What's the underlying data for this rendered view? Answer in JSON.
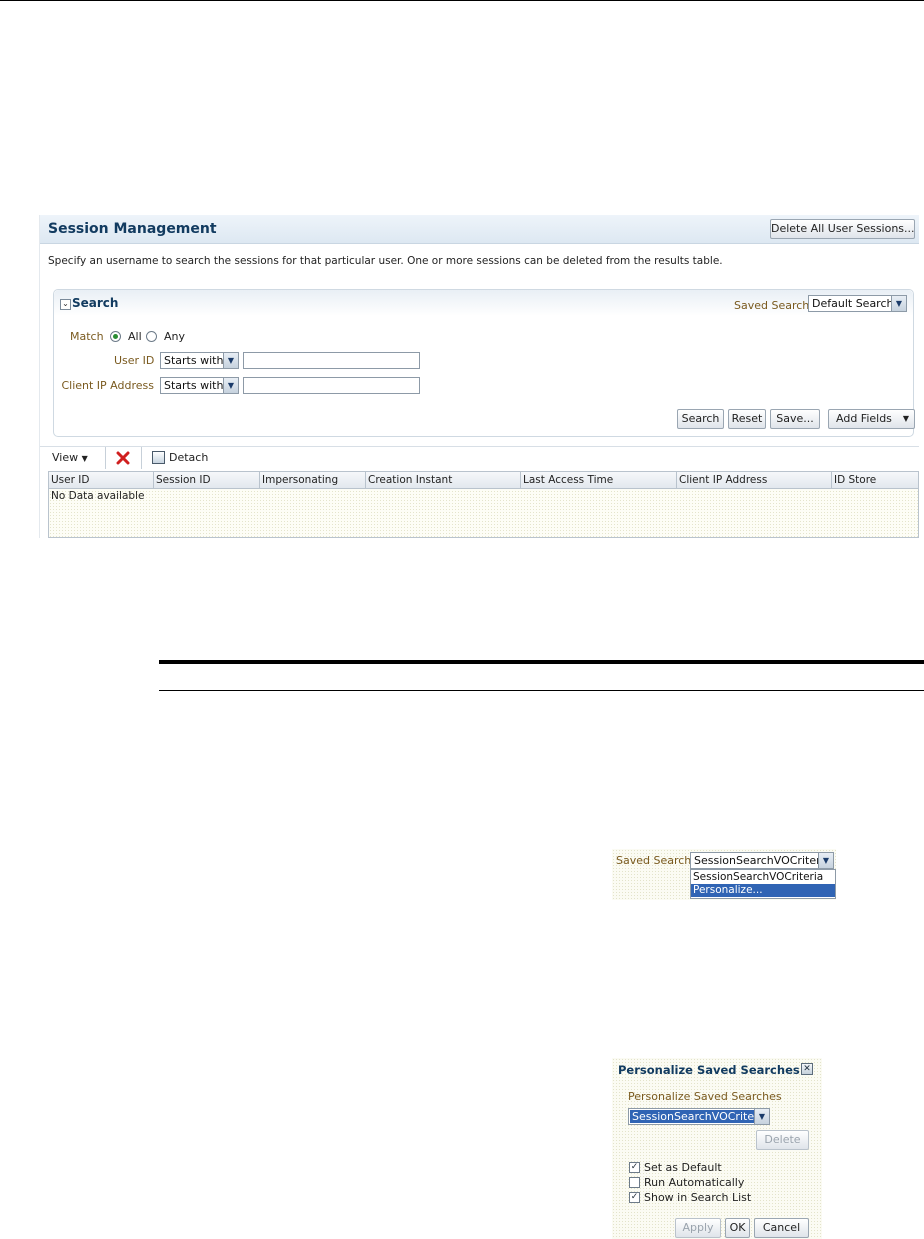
{
  "session_management": {
    "title": "Session Management",
    "delete_all_label": "Delete All User Sessions...",
    "description": "Specify an username to search the sessions for that particular user. One or more sessions can be deleted from the results table."
  },
  "search": {
    "title": "Search",
    "saved_search_label": "Saved Search",
    "saved_search_value": "Default Search",
    "match_label": "Match",
    "match_all": "All",
    "match_any": "Any",
    "match_selected": "All",
    "user_id_label": "User ID",
    "user_id_operator": "Starts with",
    "user_id_value": "",
    "client_ip_label": "Client IP Address",
    "client_ip_operator": "Starts with",
    "client_ip_value": "",
    "buttons": {
      "search": "Search",
      "reset": "Reset",
      "save": "Save...",
      "add_fields": "Add Fields"
    }
  },
  "toolbar": {
    "view": "View",
    "detach": "Detach"
  },
  "table": {
    "columns": [
      "User ID",
      "Session ID",
      "Impersonating",
      "Creation Instant",
      "Last Access Time",
      "Client IP Address",
      "ID Store"
    ],
    "empty_text": "No Data available"
  },
  "saved_search_dropdown": {
    "label": "Saved Search",
    "selected": "SessionSearchVOCriteria",
    "options": [
      "SessionSearchVOCriteria",
      "Personalize..."
    ],
    "highlighted_index": 1
  },
  "personalize_dialog": {
    "title": "Personalize Saved Searches",
    "subtitle": "Personalize Saved Searches",
    "selected_search": "SessionSearchVOCriteria",
    "delete_label": "Delete",
    "checkboxes": [
      {
        "label": "Set as Default",
        "checked": true
      },
      {
        "label": "Run Automatically",
        "checked": false
      },
      {
        "label": "Show in Search List",
        "checked": true
      }
    ],
    "apply_label": "Apply",
    "ok_label": "OK",
    "cancel_label": "Cancel"
  },
  "icons": {
    "delete": "delete-x-icon",
    "detach": "detach-icon",
    "close": "close-icon",
    "toggle": "collapse-toggle-icon"
  },
  "colors": {
    "title": "#123b60",
    "label": "#7a5a1f",
    "selection": "#3064b4",
    "delete_icon": "#d01f1f"
  }
}
